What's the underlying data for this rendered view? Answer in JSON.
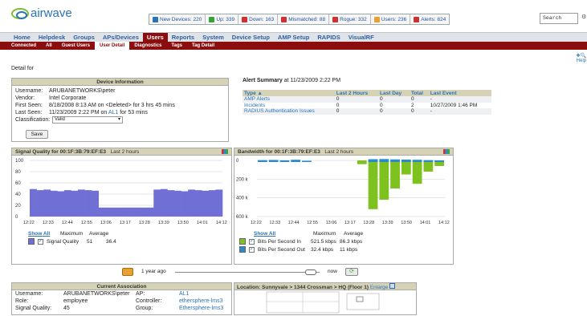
{
  "header": {
    "logo_text": "airwave",
    "stats": [
      {
        "label": "New Devices: 220",
        "icon": "new-devices-icon",
        "color": "#2a73b8"
      },
      {
        "label": "Up: 339",
        "icon": "up-icon",
        "color": "#3aa03a"
      },
      {
        "label": "Down: 163",
        "icon": "down-icon",
        "color": "#d03030"
      },
      {
        "label": "Mismatched: 88",
        "icon": "mismatch-icon",
        "color": "#d03030"
      },
      {
        "label": "Rogue: 332",
        "icon": "rogue-icon",
        "color": "#d03030"
      },
      {
        "label": "Users: 236",
        "icon": "users-icon",
        "color": "#e8a030"
      },
      {
        "label": "Alerts: 824",
        "icon": "alerts-icon",
        "color": "#d03030"
      }
    ],
    "search_value": "Search"
  },
  "nav": {
    "tabs": [
      "Home",
      "Helpdesk",
      "Groups",
      "APs/Devices",
      "Users",
      "Reports",
      "System",
      "Device Setup",
      "AMP Setup",
      "RAPIDS",
      "VisualRF"
    ],
    "active": "Users"
  },
  "subnav": {
    "tabs": [
      "Connected",
      "All",
      "Guest Users",
      "User Detail",
      "Diagnostics",
      "Tags",
      "Tag Detail"
    ],
    "active": "User Detail"
  },
  "help": {
    "label": "Help"
  },
  "page": {
    "detail_for": "Detail for"
  },
  "device_info": {
    "title": "Device Information",
    "rows": [
      {
        "k": "Username:",
        "v": "ARUBANETWORKS\\peter"
      },
      {
        "k": "Vendor:",
        "v": "Intel Corporate"
      },
      {
        "k": "First Seen:",
        "v": "8/18/2008 8:13 AM on <Deleted> for 3 hrs 45 mins"
      },
      {
        "k": "Last Seen:",
        "v_pre": "11/23/2009 2:22 PM on ",
        "v_link": "AL1",
        "v_post": " for 53 mins"
      }
    ],
    "classification_label": "Classification:",
    "classification_value": "Valid",
    "save_label": "Save"
  },
  "alert_summary": {
    "title": "Alert Summary",
    "subtitle": "at 11/23/2009 2:22 PM",
    "columns": [
      "Type ▲",
      "Last 2 Hours",
      "Last Day",
      "Total",
      "Last Event"
    ],
    "rows": [
      [
        "AMP Alerts",
        "0",
        "0",
        "0",
        "-"
      ],
      [
        "Incidents",
        "0",
        "0",
        "2",
        "10/27/2009 1:46 PM"
      ],
      [
        "RADIUS Authentication Issues",
        "0",
        "0",
        "0",
        "-"
      ]
    ]
  },
  "signal_chart": {
    "title": "Signal Quality for 00:1F:3B:79:EF:E3",
    "range": "Last 2 hours",
    "show_all": "Show All",
    "col_max": "Maximum",
    "col_avg": "Average",
    "series_label": "Signal Quality",
    "series_max": "51",
    "series_avg": "36.4",
    "color": "#6f6fd6"
  },
  "bandwidth_chart": {
    "title": "Bandwidth for 00:1F:3B:79:EF:E3",
    "range": "Last 2 hours",
    "show_all": "Show All",
    "col_max": "Maximum",
    "col_avg": "Average",
    "in_label": "Bits Per Second In",
    "in_max": "521.5 kbps",
    "in_avg": "86.3 kbps",
    "out_label": "Bits Per Second Out",
    "out_max": "32.4 kbps",
    "out_avg": "11 kbps",
    "in_color": "#7dc21e",
    "out_color": "#2a8ad0"
  },
  "chart_data": [
    {
      "type": "area",
      "title": "Signal Quality for 00:1F:3B:79:EF:E3",
      "x": [
        "12:22",
        "12:33",
        "12:44",
        "12:55",
        "13:06",
        "13:17",
        "13:28",
        "13:39",
        "13:50",
        "14:01",
        "14:12"
      ],
      "ylim": [
        0,
        100
      ],
      "yticks": [
        "100",
        "80",
        "60",
        "40",
        "20",
        "0"
      ],
      "series": [
        {
          "name": "Signal Quality",
          "values": [
            49,
            47,
            48,
            46,
            45,
            47,
            46,
            48,
            47,
            46,
            16,
            16,
            16,
            16,
            16,
            16,
            16,
            16,
            48,
            49,
            47,
            46,
            45,
            48,
            47,
            46,
            47,
            48
          ]
        }
      ]
    },
    {
      "type": "bar",
      "title": "Bandwidth for 00:1F:3B:79:EF:E3",
      "x": [
        "12:22",
        "12:33",
        "12:44",
        "12:55",
        "13:06",
        "13:17",
        "13:28",
        "13:39",
        "13:50",
        "14:01",
        "14:12"
      ],
      "ylim": [
        -600,
        0
      ],
      "yticks": [
        "0",
        "200 k",
        "400 k",
        "600 k"
      ],
      "series": [
        {
          "name": "Bits Per Second In",
          "values": [
            0,
            0,
            0,
            0,
            0,
            0,
            0,
            0,
            0,
            -40,
            -521,
            -420,
            -300,
            -150,
            -250,
            -120,
            -60
          ]
        },
        {
          "name": "Bits Per Second Out",
          "values": [
            20,
            22,
            18,
            24,
            10,
            0,
            0,
            0,
            0,
            0,
            30,
            32,
            28,
            26,
            24,
            20,
            18
          ]
        }
      ]
    }
  ],
  "timebar": {
    "left_label": "1 year ago",
    "right_label": "now"
  },
  "association": {
    "title": "Current Association",
    "rows": [
      {
        "k1": "Username:",
        "v1": "ARUBANETWORKS\\peter",
        "k2": "AP:",
        "v2": "AL1"
      },
      {
        "k1": "Role:",
        "v1": "employee",
        "k2": "Controller:",
        "v2": "ethersphere-lms3"
      },
      {
        "k1": "Signal Quality:",
        "v1": "45",
        "k2": "Group:",
        "v2": "Ethersphere-lms3"
      }
    ]
  },
  "location": {
    "title": "Location: Sunnyvale > 1344 Crossman > HQ (Floor 1)",
    "enlarge": "Enlarge"
  }
}
